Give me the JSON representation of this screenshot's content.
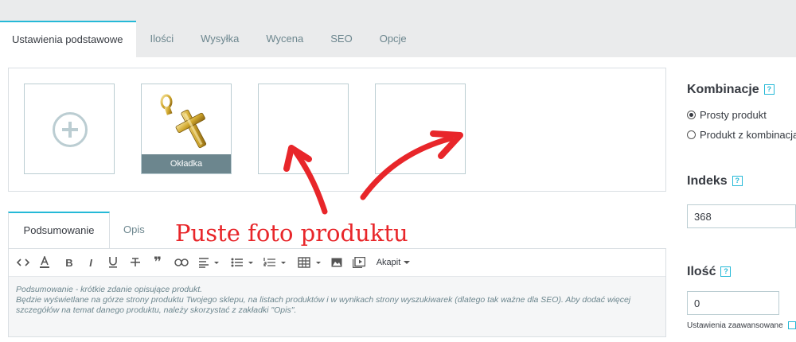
{
  "tabs": [
    "Ustawienia podstawowe",
    "Ilości",
    "Wysyłka",
    "Wycena",
    "SEO",
    "Opcje"
  ],
  "images": {
    "cover_label": "Okładka"
  },
  "description_tabs": [
    "Podsumowanie",
    "Opis"
  ],
  "editor": {
    "paragraph_label": "Akapit",
    "summary_text": "Podsumowanie - krótkie zdanie opisujące produkt.\nBędzie wyświetlane na górze strony produktu Twojego sklepu, na listach produktów i w wynikach strony wyszukiwarek (dlatego tak ważne dla SEO). Aby dodać więcej szczegółów na temat danego produktu, należy skorzystać z zakładki \"Opis\"."
  },
  "annotation": "Puste foto produktu",
  "sidebar": {
    "combinations_title": "Kombinacje",
    "options": [
      "Prosty produkt",
      "Produkt z kombinacja"
    ],
    "selected_option": "Prosty produkt",
    "index_title": "Indeks",
    "index_value": "368",
    "quantity_title": "Ilość",
    "quantity_value": "0",
    "advanced_link": "Ustawienia zaawansowane",
    "help_mark": "?"
  },
  "colors": {
    "accent": "#25b9d7",
    "annotation": "#e8262a"
  }
}
